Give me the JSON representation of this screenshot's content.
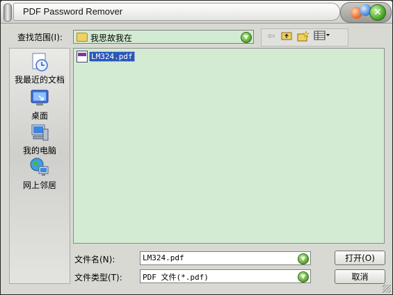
{
  "window": {
    "title": "PDF Password Remover"
  },
  "lookin": {
    "label": "查找范围(I):",
    "value": "我思故我在"
  },
  "toolbar": {
    "icons": [
      "back-icon",
      "up-folder-icon",
      "new-folder-icon",
      "view-menu-icon"
    ]
  },
  "places": [
    {
      "name": "recent-docs",
      "label": "我最近的文档",
      "icon": "recent-docs-icon"
    },
    {
      "name": "desktop",
      "label": "桌面",
      "icon": "desktop-icon"
    },
    {
      "name": "my-computer",
      "label": "我的电脑",
      "icon": "my-computer-icon"
    },
    {
      "name": "network",
      "label": "网上邻居",
      "icon": "network-icon"
    }
  ],
  "files": [
    {
      "name": "LM324.pdf",
      "selected": true
    }
  ],
  "filename": {
    "label": "文件名(N):",
    "value": "LM324.pdf"
  },
  "filetype": {
    "label": "文件类型(T):",
    "value": "PDF 文件(*.pdf)"
  },
  "buttons": {
    "open": "打开(O)",
    "cancel": "取消"
  },
  "colors": {
    "list_bg": "#d3ebd3",
    "selection": "#2a56b8"
  }
}
